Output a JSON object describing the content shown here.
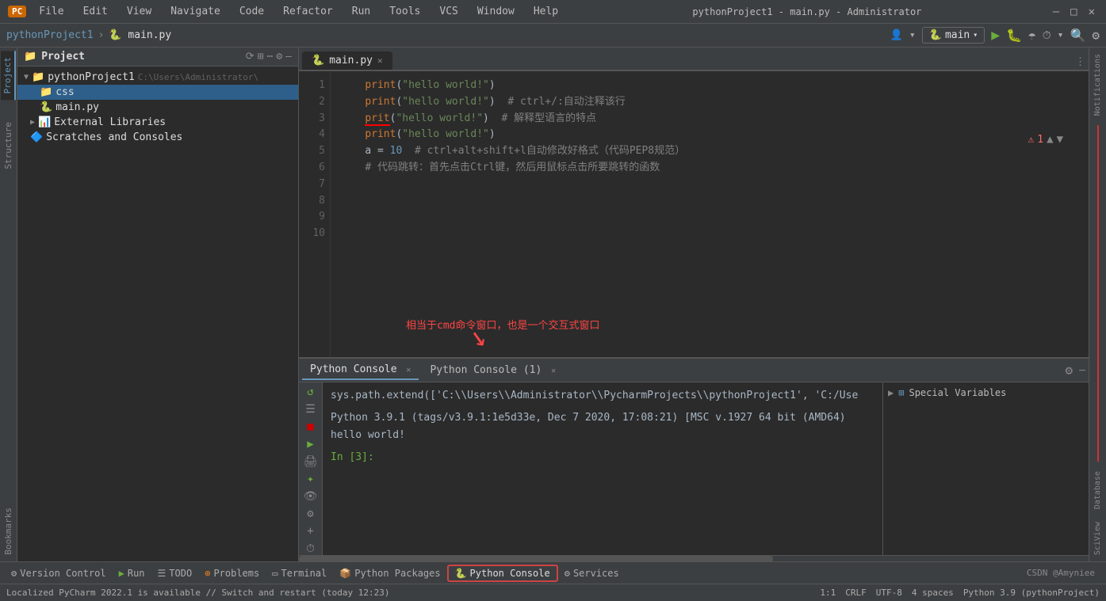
{
  "titlebar": {
    "title": "pythonProject1 - main.py - Administrator",
    "logo": "PC"
  },
  "menubar": {
    "items": [
      "File",
      "Edit",
      "View",
      "Navigate",
      "Code",
      "Refactor",
      "Run",
      "Tools",
      "VCS",
      "Window",
      "Help"
    ]
  },
  "navbar": {
    "breadcrumb1": "pythonProject1",
    "breadcrumb2": "main.py",
    "run_config": "main",
    "user_icon": "👤"
  },
  "project": {
    "title": "Project",
    "root": "pythonProject1",
    "root_path": "C:\\Users\\Administrator\\",
    "items": [
      {
        "label": "css",
        "type": "folder",
        "indent": 16,
        "selected": true
      },
      {
        "label": "main.py",
        "type": "pyfile",
        "indent": 16
      },
      {
        "label": "External Libraries",
        "type": "folder",
        "indent": 8
      },
      {
        "label": "Scratches and Consoles",
        "type": "folder",
        "indent": 8
      }
    ]
  },
  "editor": {
    "filename": "main.py",
    "lines": [
      {
        "num": 1,
        "content": "    print(\"hello world!\")"
      },
      {
        "num": 2,
        "content": "    print(\"hello world!\")  # ctrl+/:自动注释该行"
      },
      {
        "num": 3,
        "content": ""
      },
      {
        "num": 4,
        "content": "    prit(\"hello world!\")  # 解释型语言的特点"
      },
      {
        "num": 5,
        "content": ""
      },
      {
        "num": 6,
        "content": "    print(\"hello world!\")"
      },
      {
        "num": 7,
        "content": ""
      },
      {
        "num": 8,
        "content": "    a = 10  # ctrl+alt+shift+l自动修改好格式（代码PEP8规范）"
      },
      {
        "num": 9,
        "content": ""
      },
      {
        "num": 10,
        "content": "    # 代码跳转：首先点击Ctrl键，然后用鼠标点击所要跳转的函数"
      }
    ],
    "error_count": "1"
  },
  "annotation": {
    "text": "相当于cmd命令窗口，也是一个交互式窗口",
    "arrow": "↘"
  },
  "console": {
    "tabs": [
      {
        "label": "Python Console",
        "active": true
      },
      {
        "label": "Python Console (1)",
        "active": false
      }
    ],
    "path_line": "sys.path.extend(['C:\\\\Users\\\\Administrator\\\\PycharmProjects\\\\pythonProject1', 'C:/Use",
    "version_line": "Python 3.9.1 (tags/v3.9.1:1e5d33e, Dec  7 2020, 17:08:21) [MSC v.1927 64 bit (AMD64)",
    "output_line": "hello world!",
    "prompt": "In [3]:",
    "vars_header": "Special Variables"
  },
  "bottom_toolbar": {
    "items": [
      {
        "icon": "⚙",
        "label": "Version Control"
      },
      {
        "icon": "▶",
        "label": "Run"
      },
      {
        "icon": "☰",
        "label": "TODO"
      },
      {
        "icon": "⊕",
        "label": "Problems"
      },
      {
        "icon": "▭",
        "label": "Terminal"
      },
      {
        "icon": "📦",
        "label": "Python Packages"
      },
      {
        "icon": "🐍",
        "label": "Python Console",
        "highlighted": true
      },
      {
        "icon": "⚙",
        "label": "Services"
      }
    ]
  },
  "statusbar": {
    "message": "Localized PyCharm 2022.1 is available // Switch and restart (today 12:23)",
    "position": "1:1",
    "line_ending": "CRLF",
    "encoding": "UTF-8",
    "indent": "4 spaces",
    "python_ver": "Python 3.9 (pythonProject)",
    "csdn": "CSDN @Amyniee"
  },
  "right_panel": {
    "notifications": "Notifications",
    "database": "Database",
    "sciview": "SciView"
  },
  "sidebar_labels": {
    "structure": "Structure",
    "bookmarks": "Bookmarks"
  }
}
